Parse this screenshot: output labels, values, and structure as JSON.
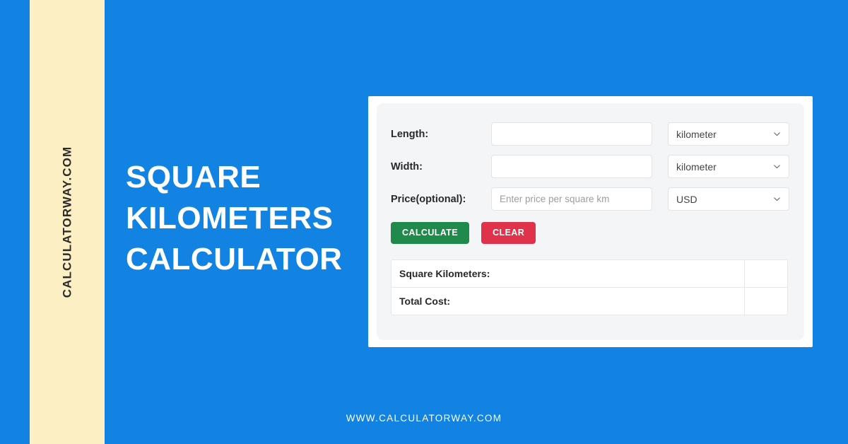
{
  "brand": {
    "vertical_text": "CALCULATORWAY.COM",
    "footer_url": "WWW.CALCULATORWAY.COM",
    "headline": "Square Kilometers Calculator",
    "accent_blue": "#1283e2",
    "stripe_cream": "#fcefc4"
  },
  "calculator": {
    "rows": [
      {
        "label": "Length:",
        "value": "",
        "placeholder": "",
        "unit": "kilometer"
      },
      {
        "label": "Width:",
        "value": "",
        "placeholder": "",
        "unit": "kilometer"
      },
      {
        "label": "Price(optional):",
        "value": "",
        "placeholder": "Enter price per square km",
        "unit": "USD"
      }
    ],
    "buttons": {
      "calculate": "CALCULATE",
      "clear": "CLEAR",
      "calculate_color": "#208a4c",
      "clear_color": "#e0324a"
    },
    "results": [
      {
        "label": "Square Kilometers:",
        "value": ""
      },
      {
        "label": "Total Cost:",
        "value": ""
      }
    ]
  }
}
